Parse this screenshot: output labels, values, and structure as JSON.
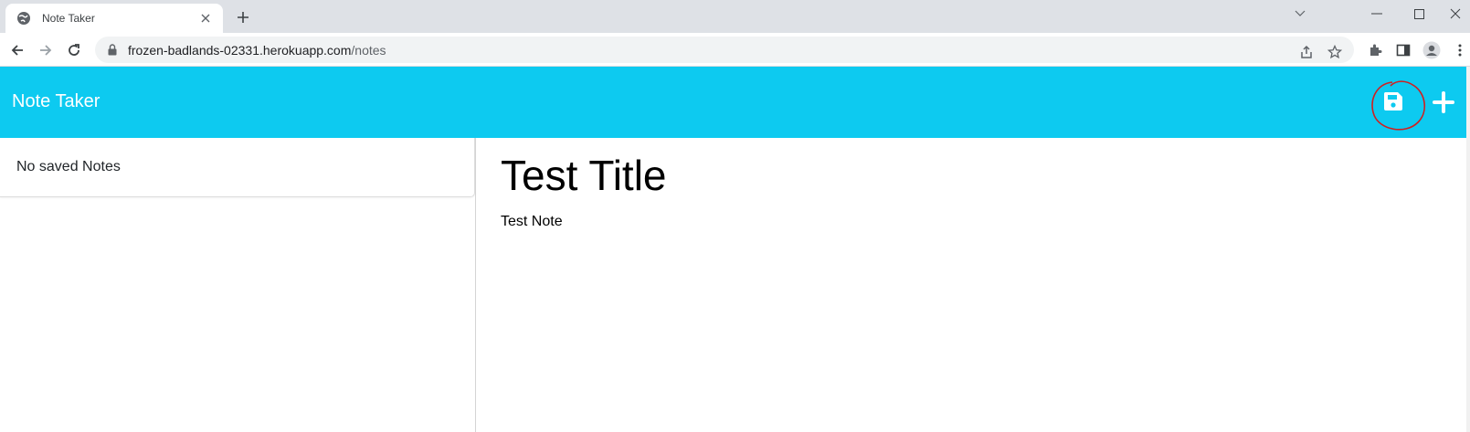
{
  "browser": {
    "tab": {
      "title": "Note Taker",
      "favicon": "globe-icon"
    },
    "url": {
      "host": "frozen-badlands-02331.herokuapp.com",
      "path": "/notes"
    }
  },
  "app": {
    "brand": "Note Taker",
    "navbar_color": "#0dcaf0",
    "save_icon": "floppy-disk-icon",
    "new_icon": "plus-icon",
    "annotation_color": "#d11f1f"
  },
  "sidebar": {
    "empty_label": "No saved Notes"
  },
  "note": {
    "title": "Test Title",
    "text": "Test Note"
  }
}
